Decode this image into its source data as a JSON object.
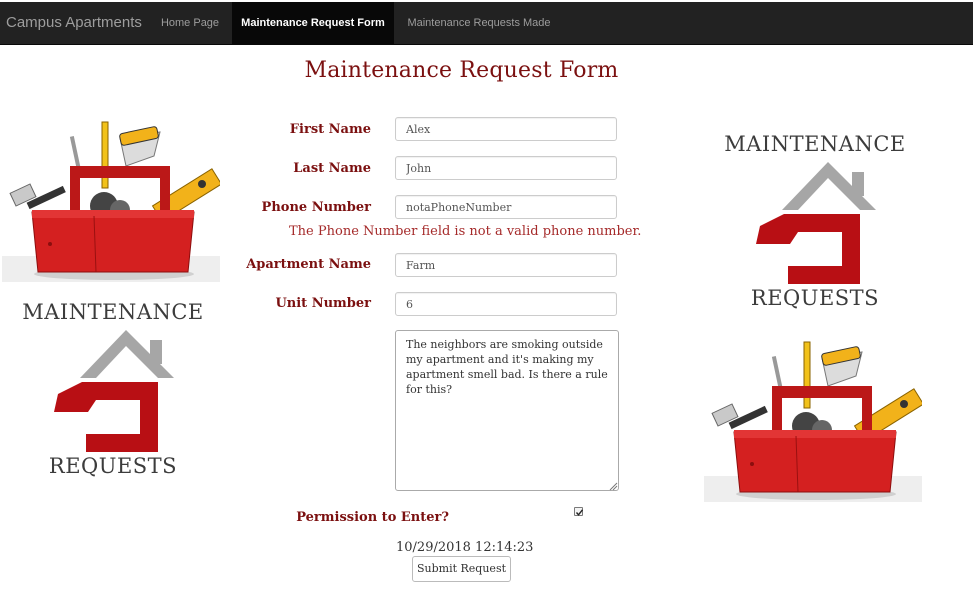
{
  "navbar": {
    "brand": "Campus Apartments",
    "items": [
      {
        "label": "Home Page",
        "active": false
      },
      {
        "label": "Maintenance Request Form",
        "active": true
      },
      {
        "label": "Maintenance Requests Made",
        "active": false
      }
    ]
  },
  "page": {
    "title": "Maintenance Request Form"
  },
  "form": {
    "first_name": {
      "label": "First Name",
      "value": "Alex"
    },
    "last_name": {
      "label": "Last Name",
      "value": "John"
    },
    "phone": {
      "label": "Phone Number",
      "value": "notaPhoneNumber",
      "error": "The Phone Number field is not a valid phone number."
    },
    "apartment": {
      "label": "Apartment Name",
      "value": "Farm"
    },
    "unit": {
      "label": "Unit Number",
      "value": "6"
    },
    "description": {
      "value": "The neighbors are smoking outside my apartment and it's making my apartment smell bad. Is there a rule for this?"
    },
    "permission": {
      "label": "Permission to Enter?",
      "checked": true
    },
    "timestamp": "10/29/2018 12:14:23",
    "submit_label": "Submit Request"
  },
  "logo": {
    "top_text": "MAINTENANCE",
    "bottom_text": "REQUESTS"
  },
  "colors": {
    "navbar_bg": "#222222",
    "nav_active_bg": "#080808",
    "accent_maroon": "#7b1010",
    "toolbox_red": "#d42020",
    "logo_red": "#b80f14",
    "logo_gray": "#a6a6a6"
  }
}
